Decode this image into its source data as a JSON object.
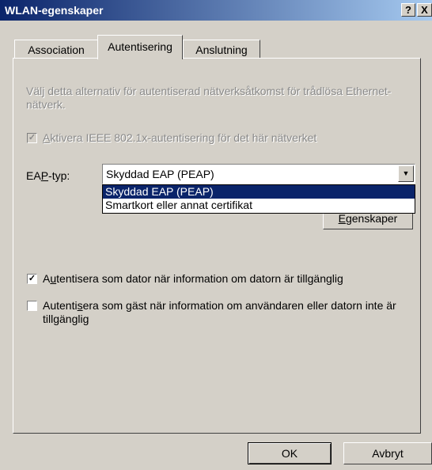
{
  "window": {
    "title": "WLAN-egenskaper",
    "help_label": "?",
    "close_label": "X"
  },
  "tabs": [
    {
      "label": "Association",
      "active": false
    },
    {
      "label": "Autentisering",
      "active": true
    },
    {
      "label": "Anslutning",
      "active": false
    }
  ],
  "panel": {
    "description": "Välj detta alternativ för autentiserad nätverksåtkomst för trådlösa Ethernet-nätverk.",
    "ieee_checkbox": {
      "label_prefix": "",
      "label_hotkey": "A",
      "label_rest": "ktivera IEEE 802.1x-autentisering för det här nätverket",
      "checked": true,
      "disabled": true
    },
    "eap": {
      "label_prefix": "EA",
      "label_hotkey": "P",
      "label_rest": "-typ:",
      "selected": "Skyddad EAP (PEAP)",
      "options": [
        "Skyddad EAP (PEAP)",
        "Smartkort eller annat certifikat"
      ]
    },
    "properties_button": {
      "hotkey": "E",
      "rest": "genskaper"
    },
    "computer_auth": {
      "label_prefix": "A",
      "label_hotkey": "u",
      "label_rest": "tentisera som dator när information om datorn är tillgänglig",
      "checked": true
    },
    "guest_auth": {
      "label_prefix": "Autenti",
      "label_hotkey": "s",
      "label_rest": "era som gäst när information om användaren eller datorn inte är tillgänglig",
      "checked": false
    }
  },
  "buttons": {
    "ok": "OK",
    "cancel": "Avbryt"
  },
  "colors": {
    "titlebar": "#0a246a",
    "face": "#d4d0c8",
    "selection": "#0a246a"
  }
}
